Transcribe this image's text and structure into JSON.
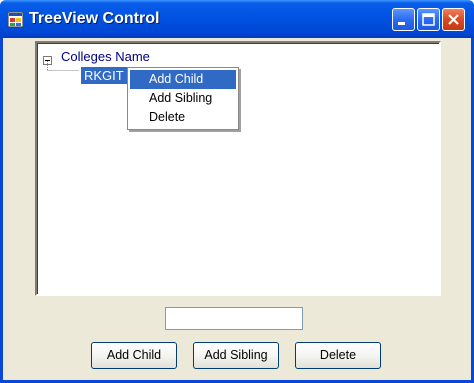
{
  "window": {
    "title": "TreeView Control"
  },
  "titlebar_buttons": {
    "minimize_icon": "minimize-icon",
    "maximize_icon": "maximize-icon",
    "close_icon": "close-icon"
  },
  "tree": {
    "root": {
      "label": "Colleges Name",
      "expander": "−",
      "expanded": true
    },
    "children": [
      {
        "label": "RKGIT",
        "selected": true
      }
    ]
  },
  "context_menu": {
    "items": [
      {
        "label": "Add Child",
        "highlighted": true
      },
      {
        "label": "Add Sibling",
        "highlighted": false
      },
      {
        "label": "Delete",
        "highlighted": false
      }
    ]
  },
  "input": {
    "value": "",
    "placeholder": ""
  },
  "buttons": {
    "add_child": "Add Child",
    "add_sibling": "Add Sibling",
    "delete": "Delete"
  },
  "colors": {
    "titlebar": "#0054e3",
    "window_face": "#ece9d8",
    "selection": "#316ac5",
    "tree_text": "#000080"
  }
}
